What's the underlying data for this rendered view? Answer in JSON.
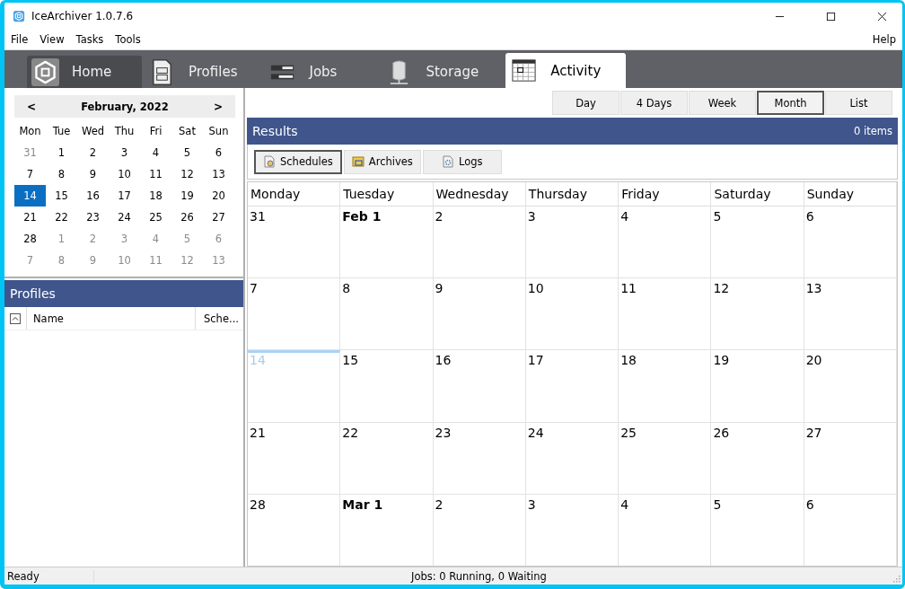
{
  "window": {
    "title": "IceArchiver 1.0.7.6"
  },
  "menu": [
    "File",
    "View",
    "Tasks",
    "Tools"
  ],
  "menu_right": "Help",
  "tabs": [
    {
      "label": "Home",
      "kind": "home",
      "selected": false,
      "hovered": true
    },
    {
      "label": "Profiles",
      "kind": "profiles",
      "selected": false,
      "hovered": false
    },
    {
      "label": "Jobs",
      "kind": "jobs",
      "selected": false,
      "hovered": false
    },
    {
      "label": "Storage",
      "kind": "storage",
      "selected": false,
      "hovered": false
    },
    {
      "label": "Activity",
      "kind": "activity",
      "selected": true,
      "hovered": false
    }
  ],
  "mini_calendar": {
    "prev": "<",
    "next": ">",
    "title": "February, 2022",
    "weekdays": [
      "Mon",
      "Tue",
      "Wed",
      "Thu",
      "Fri",
      "Sat",
      "Sun"
    ],
    "weeks": [
      [
        {
          "day": "31",
          "muted": true,
          "selected": false
        },
        {
          "day": "1",
          "muted": false,
          "selected": false
        },
        {
          "day": "2",
          "muted": false,
          "selected": false
        },
        {
          "day": "3",
          "muted": false,
          "selected": false
        },
        {
          "day": "4",
          "muted": false,
          "selected": false
        },
        {
          "day": "5",
          "muted": false,
          "selected": false
        },
        {
          "day": "6",
          "muted": false,
          "selected": false
        }
      ],
      [
        {
          "day": "7",
          "muted": false,
          "selected": false
        },
        {
          "day": "8",
          "muted": false,
          "selected": false
        },
        {
          "day": "9",
          "muted": false,
          "selected": false
        },
        {
          "day": "10",
          "muted": false,
          "selected": false
        },
        {
          "day": "11",
          "muted": false,
          "selected": false
        },
        {
          "day": "12",
          "muted": false,
          "selected": false
        },
        {
          "day": "13",
          "muted": false,
          "selected": false
        }
      ],
      [
        {
          "day": "14",
          "muted": false,
          "selected": true
        },
        {
          "day": "15",
          "muted": false,
          "selected": false
        },
        {
          "day": "16",
          "muted": false,
          "selected": false
        },
        {
          "day": "17",
          "muted": false,
          "selected": false
        },
        {
          "day": "18",
          "muted": false,
          "selected": false
        },
        {
          "day": "19",
          "muted": false,
          "selected": false
        },
        {
          "day": "20",
          "muted": false,
          "selected": false
        }
      ],
      [
        {
          "day": "21",
          "muted": false,
          "selected": false
        },
        {
          "day": "22",
          "muted": false,
          "selected": false
        },
        {
          "day": "23",
          "muted": false,
          "selected": false
        },
        {
          "day": "24",
          "muted": false,
          "selected": false
        },
        {
          "day": "25",
          "muted": false,
          "selected": false
        },
        {
          "day": "26",
          "muted": false,
          "selected": false
        },
        {
          "day": "27",
          "muted": false,
          "selected": false
        }
      ],
      [
        {
          "day": "28",
          "muted": false,
          "selected": false
        },
        {
          "day": "1",
          "muted": true,
          "selected": false
        },
        {
          "day": "2",
          "muted": true,
          "selected": false
        },
        {
          "day": "3",
          "muted": true,
          "selected": false
        },
        {
          "day": "4",
          "muted": true,
          "selected": false
        },
        {
          "day": "5",
          "muted": true,
          "selected": false
        },
        {
          "day": "6",
          "muted": true,
          "selected": false
        }
      ],
      [
        {
          "day": "7",
          "muted": true,
          "selected": false
        },
        {
          "day": "8",
          "muted": true,
          "selected": false
        },
        {
          "day": "9",
          "muted": true,
          "selected": false
        },
        {
          "day": "10",
          "muted": true,
          "selected": false
        },
        {
          "day": "11",
          "muted": true,
          "selected": false
        },
        {
          "day": "12",
          "muted": true,
          "selected": false
        },
        {
          "day": "13",
          "muted": true,
          "selected": false
        }
      ]
    ]
  },
  "profiles": {
    "title": "Profiles",
    "columns": [
      "Name",
      "Sche..."
    ]
  },
  "view_buttons": [
    {
      "label": "Day",
      "selected": false
    },
    {
      "label": "4 Days",
      "selected": false
    },
    {
      "label": "Week",
      "selected": false
    },
    {
      "label": "Month",
      "selected": true
    },
    {
      "label": "List",
      "selected": false
    }
  ],
  "results": {
    "title": "Results",
    "count": "0 items",
    "tabs": [
      {
        "label": "Schedules",
        "kind": "schedules",
        "selected": true
      },
      {
        "label": "Archives",
        "kind": "archives",
        "selected": false
      },
      {
        "label": "Logs",
        "kind": "logs",
        "selected": false
      }
    ]
  },
  "month": {
    "weekdays": [
      "Monday",
      "Tuesday",
      "Wednesday",
      "Thursday",
      "Friday",
      "Saturday",
      "Sunday"
    ],
    "weeks": [
      [
        {
          "day": "31",
          "kind": "normal"
        },
        {
          "day": "Feb 1",
          "kind": "month-start"
        },
        {
          "day": "2",
          "kind": "normal"
        },
        {
          "day": "3",
          "kind": "normal"
        },
        {
          "day": "4",
          "kind": "normal"
        },
        {
          "day": "5",
          "kind": "normal"
        },
        {
          "day": "6",
          "kind": "normal"
        }
      ],
      [
        {
          "day": "7",
          "kind": "normal"
        },
        {
          "day": "8",
          "kind": "normal"
        },
        {
          "day": "9",
          "kind": "normal"
        },
        {
          "day": "10",
          "kind": "normal"
        },
        {
          "day": "11",
          "kind": "normal"
        },
        {
          "day": "12",
          "kind": "normal"
        },
        {
          "day": "13",
          "kind": "normal"
        }
      ],
      [
        {
          "day": "14",
          "kind": "today"
        },
        {
          "day": "15",
          "kind": "normal"
        },
        {
          "day": "16",
          "kind": "normal"
        },
        {
          "day": "17",
          "kind": "normal"
        },
        {
          "day": "18",
          "kind": "normal"
        },
        {
          "day": "19",
          "kind": "normal"
        },
        {
          "day": "20",
          "kind": "normal"
        }
      ],
      [
        {
          "day": "21",
          "kind": "normal"
        },
        {
          "day": "22",
          "kind": "normal"
        },
        {
          "day": "23",
          "kind": "normal"
        },
        {
          "day": "24",
          "kind": "normal"
        },
        {
          "day": "25",
          "kind": "normal"
        },
        {
          "day": "26",
          "kind": "normal"
        },
        {
          "day": "27",
          "kind": "normal"
        }
      ],
      [
        {
          "day": "28",
          "kind": "normal"
        },
        {
          "day": "Mar 1",
          "kind": "month-start"
        },
        {
          "day": "2",
          "kind": "normal"
        },
        {
          "day": "3",
          "kind": "normal"
        },
        {
          "day": "4",
          "kind": "normal"
        },
        {
          "day": "5",
          "kind": "normal"
        },
        {
          "day": "6",
          "kind": "normal"
        }
      ]
    ]
  },
  "status_bar": {
    "left": "Ready",
    "center": "Jobs: 0 Running, 0 Waiting"
  }
}
